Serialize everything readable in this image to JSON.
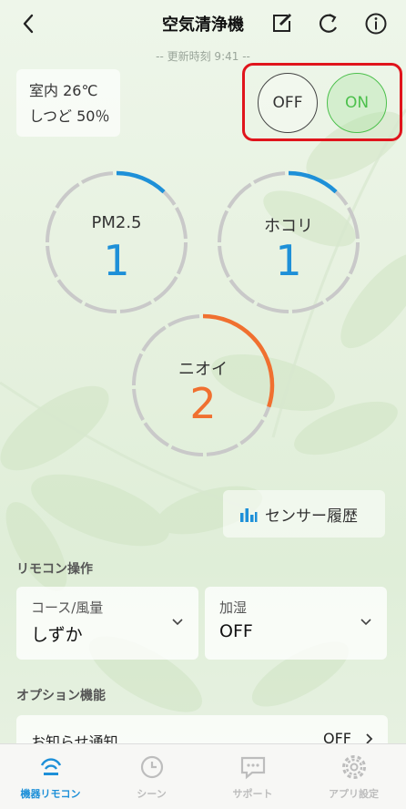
{
  "header": {
    "title": "空気清浄機",
    "updated": "-- 更新時刻 9:41 --",
    "icons": [
      "back-icon",
      "edit-icon",
      "refresh-icon",
      "info-icon"
    ]
  },
  "environment": {
    "room_temp": "室内 26℃",
    "humidity": "しつど 50％"
  },
  "power": {
    "off_label": "OFF",
    "on_label": "ON",
    "selected": "ON",
    "colors": {
      "on": "#4cc04c",
      "highlight": "#e0141c"
    }
  },
  "gauges": [
    {
      "label": "PM2.5",
      "value": "1",
      "level": 0.12,
      "color": "#1e90d8"
    },
    {
      "label": "ホコリ",
      "value": "1",
      "level": 0.12,
      "color": "#1e90d8"
    },
    {
      "label": "ニオイ",
      "value": "2",
      "level": 0.3,
      "color": "#f07030"
    }
  ],
  "sensor_history": {
    "label": "センサー履歴",
    "icon": "bar-chart-icon"
  },
  "remote": {
    "title": "リモコン操作",
    "controls": [
      {
        "key": "コース/風量",
        "value": "しずか"
      },
      {
        "key": "加湿",
        "value": "OFF"
      }
    ]
  },
  "options": {
    "title": "オプション機能",
    "items": [
      {
        "key": "お知らせ通知",
        "value": "OFF"
      }
    ]
  },
  "nav": {
    "items": [
      {
        "label": "機器リモコン",
        "icon": "remote-icon",
        "active": true
      },
      {
        "label": "シーン",
        "icon": "clock-icon",
        "active": false
      },
      {
        "label": "サポート",
        "icon": "chat-icon",
        "active": false
      },
      {
        "label": "アプリ設定",
        "icon": "gear-icon",
        "active": false
      }
    ],
    "colors": {
      "active": "#1e90d8",
      "inactive": "#bdbdbd"
    }
  }
}
